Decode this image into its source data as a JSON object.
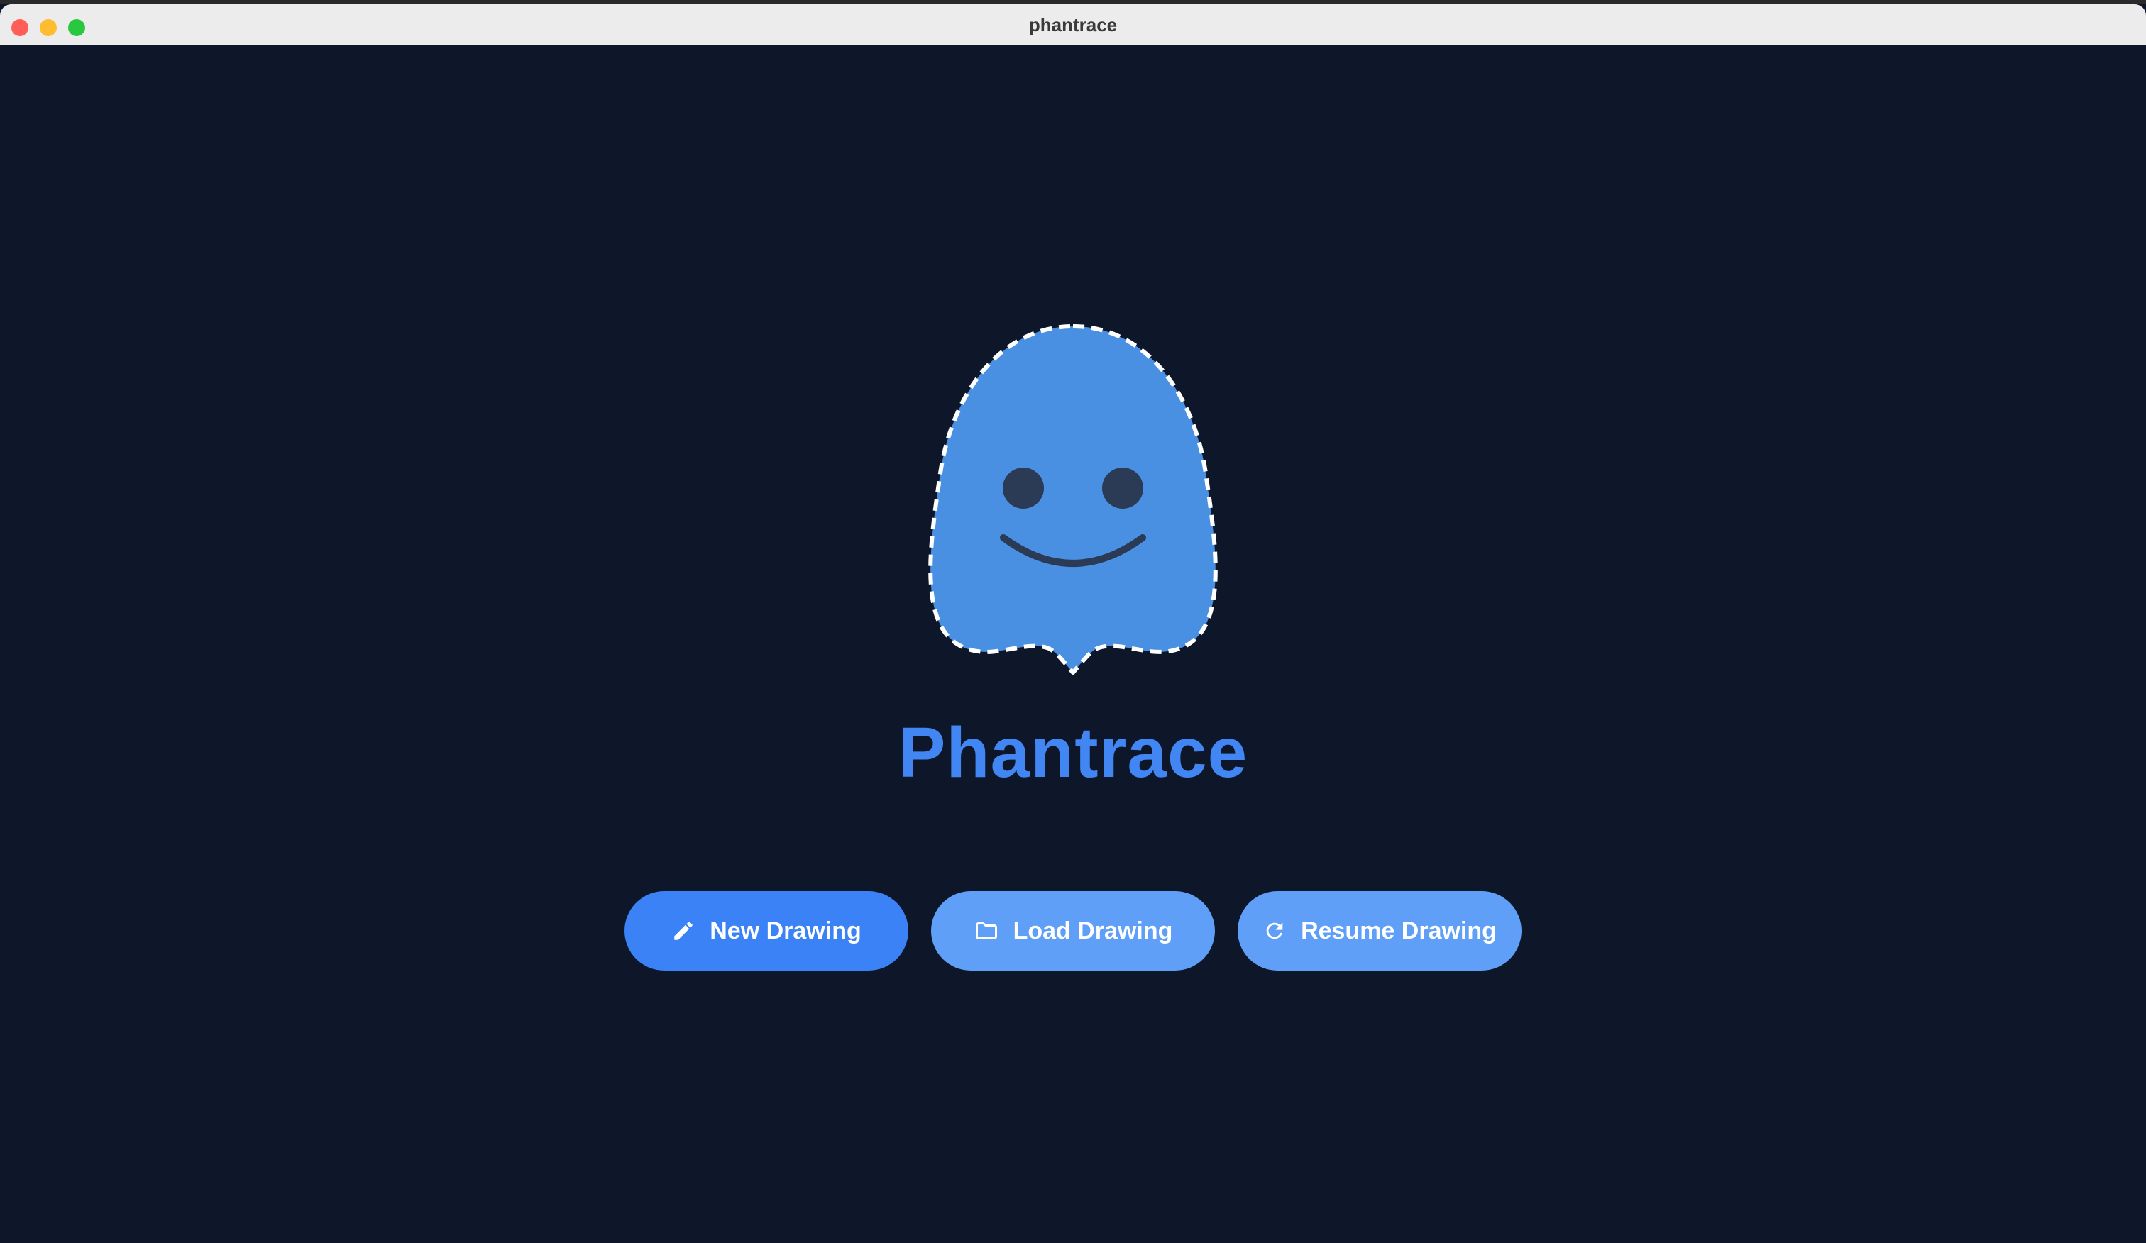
{
  "window": {
    "title": "phantrace"
  },
  "app": {
    "name": "Phantrace",
    "logo_icon": "ghost-logo-icon"
  },
  "actions": {
    "new_drawing": {
      "label": "New Drawing",
      "icon": "pencil-icon"
    },
    "load_drawing": {
      "label": "Load Drawing",
      "icon": "folder-icon"
    },
    "resume_drawing": {
      "label": "Resume Drawing",
      "icon": "refresh-icon"
    }
  },
  "colors": {
    "background": "#0e1629",
    "accent": "#3b82f6",
    "accent_light": "#5f9ff7",
    "ghost_body": "#4a90e2",
    "ghost_face": "#2b3a55"
  }
}
